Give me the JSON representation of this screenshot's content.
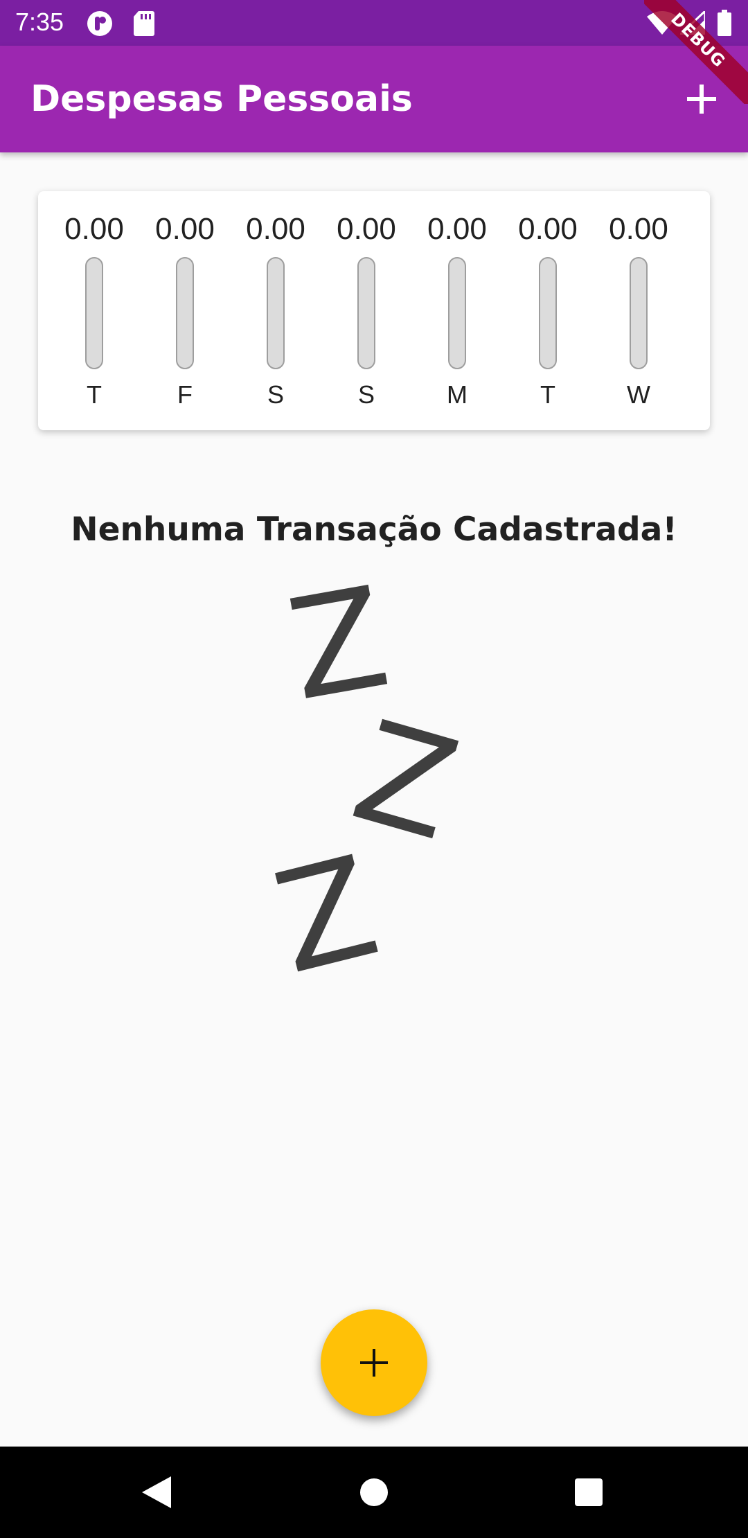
{
  "status_bar": {
    "time": "7:35",
    "left_icons": [
      "app-notification-icon",
      "sd-card-icon"
    ],
    "right_icons": [
      "wifi-icon",
      "signal-icon",
      "battery-icon"
    ],
    "background_color": "#7b1fa2"
  },
  "debug_banner": {
    "label": "DEBUG"
  },
  "app_bar": {
    "title": "Despesas Pessoais",
    "action_icon": "add-icon",
    "background_color": "#9c27b0"
  },
  "chart": {
    "days": [
      {
        "day": "T",
        "value": "0.00",
        "fraction": 0
      },
      {
        "day": "F",
        "value": "0.00",
        "fraction": 0
      },
      {
        "day": "S",
        "value": "0.00",
        "fraction": 0
      },
      {
        "day": "S",
        "value": "0.00",
        "fraction": 0
      },
      {
        "day": "M",
        "value": "0.00",
        "fraction": 0
      },
      {
        "day": "T",
        "value": "0.00",
        "fraction": 0
      },
      {
        "day": "W",
        "value": "0.00",
        "fraction": 0
      }
    ]
  },
  "empty_state": {
    "title": "Nenhuma Transação Cadastrada!",
    "illustration_text": [
      "Z",
      "Z",
      "Z"
    ],
    "illustration_icon": "sleeping-zzz-image"
  },
  "fab": {
    "icon": "add-icon",
    "background_color": "#ffc107"
  },
  "nav_bar": {
    "icons": [
      "back-icon",
      "home-icon",
      "recents-icon"
    ]
  }
}
